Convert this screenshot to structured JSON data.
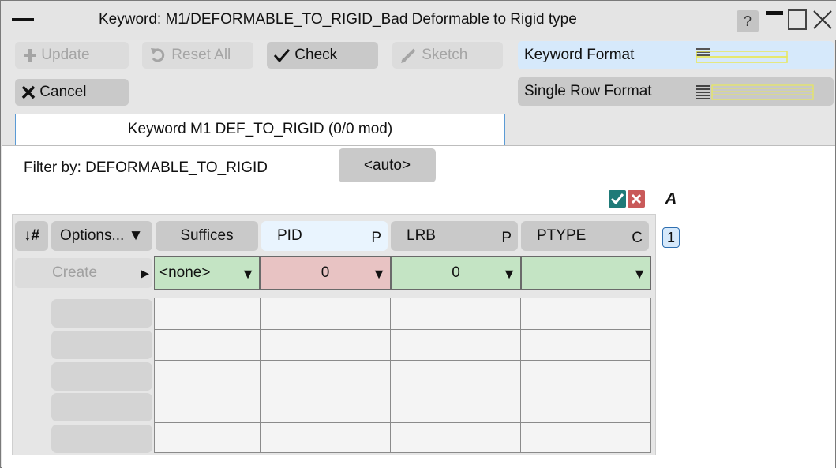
{
  "window": {
    "title": "Keyword: M1/DEFORMABLE_TO_RIGID_Bad Deformable to Rigid type",
    "help_label": "?"
  },
  "toolbar": {
    "update_label": "Update",
    "reset_label": "Reset All",
    "check_label": "Check",
    "sketch_label": "Sketch",
    "cancel_label": "Cancel"
  },
  "format": {
    "keyword_label": "Keyword Format",
    "single_row_label": "Single Row Format",
    "selected": "Keyword Format"
  },
  "keyword_tab": {
    "label": "Keyword M1 DEF_TO_RIGID (0/0 mod)"
  },
  "filter": {
    "label": "Filter by: DEFORMABLE_TO_RIGID",
    "auto_label": "<auto>"
  },
  "table": {
    "sort_label": "↓#",
    "options_label": "Options... ▼",
    "columns": [
      {
        "name": "Suffices",
        "suffix": ""
      },
      {
        "name": "PID",
        "suffix": "P"
      },
      {
        "name": "LRB",
        "suffix": "P"
      },
      {
        "name": "PTYPE",
        "suffix": "C"
      }
    ],
    "page": "1",
    "create_label": "Create",
    "create_row": {
      "suffices": "<none>",
      "pid": "0",
      "lrb": "0",
      "ptype": ""
    },
    "empty_rows": 5
  },
  "colors": {
    "valid_field": "#c4e4c4",
    "invalid_field": "#e8c3c3",
    "accent": "#5b9bd5",
    "check_green": "#1f7a78"
  },
  "icons": [
    "plus-icon",
    "undo-icon",
    "checkmark-icon",
    "pencil-icon",
    "x-icon",
    "format-lines-icon",
    "close-icon",
    "minimize-icon",
    "maximize-icon"
  ]
}
